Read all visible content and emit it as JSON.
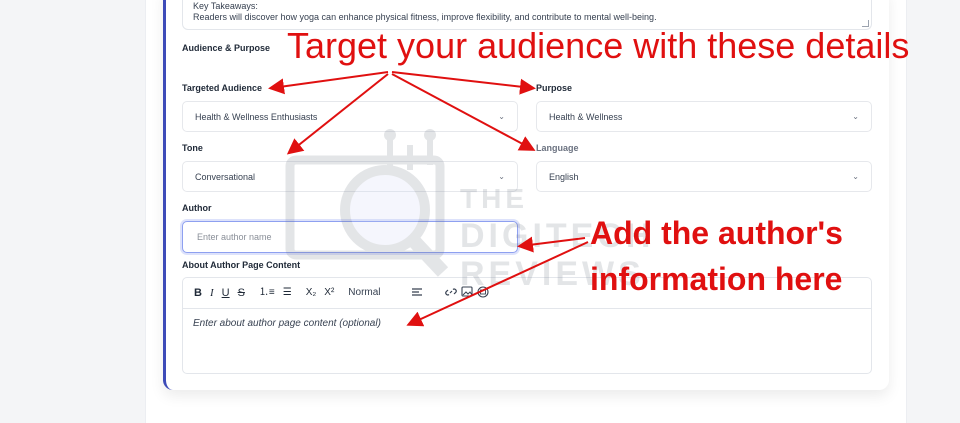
{
  "key_takeaways": {
    "heading": "Key Takeaways:",
    "text": "Readers will discover how yoga can enhance physical fitness, improve flexibility, and contribute to mental well-being."
  },
  "section_title": "Audience & Purpose",
  "fields": {
    "targeted_audience": {
      "label": "Targeted Audience",
      "value": "Health & Wellness Enthusiasts"
    },
    "purpose": {
      "label": "Purpose",
      "value": "Health & Wellness"
    },
    "tone": {
      "label": "Tone",
      "value": "Conversational"
    },
    "language": {
      "label": "Language",
      "value": "English"
    },
    "author": {
      "label": "Author",
      "placeholder": "Enter author name"
    },
    "about_author": {
      "label": "About Author Page Content",
      "placeholder": "Enter about author page content (optional)"
    }
  },
  "editor_toolbar": {
    "bold": "B",
    "italic": "I",
    "underline": "U",
    "strike": "S",
    "ordered_list": "⒈≡",
    "bullet_list": "☰",
    "subscript": "X₂",
    "superscript": "X²",
    "format": "Normal",
    "format_chevron": "⌃⌄"
  },
  "icons": {
    "select_chevron": "chevron-down-icon",
    "align": "align-icon",
    "link": "link-icon",
    "image": "image-icon",
    "video": "video-icon"
  },
  "annotations": {
    "audience_note": "Target your audience with these details",
    "author_note_line1": "Add the author's",
    "author_note_line2": "information here"
  },
  "watermark": {
    "line1": "THE",
    "line2": "DIGITECH",
    "line3": "REVIEWS"
  },
  "colors": {
    "accent": "#3d4bb8",
    "annotation": "#e01010",
    "focus": "#8ea0f0"
  }
}
